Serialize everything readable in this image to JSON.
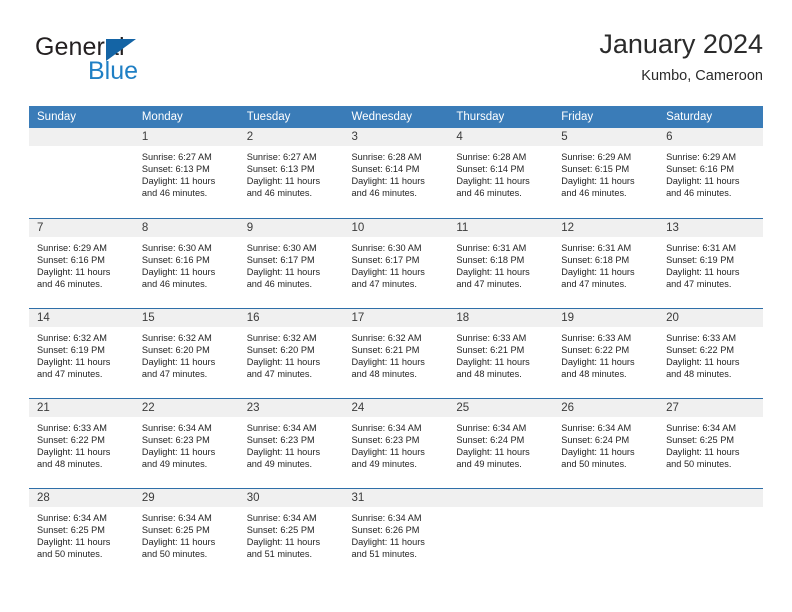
{
  "brand": {
    "name_top": "General",
    "name_bottom": "Blue",
    "flag_color": "#1464a5",
    "blue_color": "#1f7fc4"
  },
  "header": {
    "title": "January 2024",
    "subtitle": "Kumbo, Cameroon"
  },
  "theme": {
    "header_row_bg": "#3a7cb8",
    "daynum_bg": "#f0f0f0",
    "week_divider": "#2f6fa8"
  },
  "weekday_headers": [
    "Sunday",
    "Monday",
    "Tuesday",
    "Wednesday",
    "Thursday",
    "Friday",
    "Saturday"
  ],
  "weeks": [
    [
      {
        "day": "",
        "lines": []
      },
      {
        "day": "1",
        "lines": [
          "Sunrise: 6:27 AM",
          "Sunset: 6:13 PM",
          "Daylight: 11 hours",
          "and 46 minutes."
        ]
      },
      {
        "day": "2",
        "lines": [
          "Sunrise: 6:27 AM",
          "Sunset: 6:13 PM",
          "Daylight: 11 hours",
          "and 46 minutes."
        ]
      },
      {
        "day": "3",
        "lines": [
          "Sunrise: 6:28 AM",
          "Sunset: 6:14 PM",
          "Daylight: 11 hours",
          "and 46 minutes."
        ]
      },
      {
        "day": "4",
        "lines": [
          "Sunrise: 6:28 AM",
          "Sunset: 6:14 PM",
          "Daylight: 11 hours",
          "and 46 minutes."
        ]
      },
      {
        "day": "5",
        "lines": [
          "Sunrise: 6:29 AM",
          "Sunset: 6:15 PM",
          "Daylight: 11 hours",
          "and 46 minutes."
        ]
      },
      {
        "day": "6",
        "lines": [
          "Sunrise: 6:29 AM",
          "Sunset: 6:16 PM",
          "Daylight: 11 hours",
          "and 46 minutes."
        ]
      }
    ],
    [
      {
        "day": "7",
        "lines": [
          "Sunrise: 6:29 AM",
          "Sunset: 6:16 PM",
          "Daylight: 11 hours",
          "and 46 minutes."
        ]
      },
      {
        "day": "8",
        "lines": [
          "Sunrise: 6:30 AM",
          "Sunset: 6:16 PM",
          "Daylight: 11 hours",
          "and 46 minutes."
        ]
      },
      {
        "day": "9",
        "lines": [
          "Sunrise: 6:30 AM",
          "Sunset: 6:17 PM",
          "Daylight: 11 hours",
          "and 46 minutes."
        ]
      },
      {
        "day": "10",
        "lines": [
          "Sunrise: 6:30 AM",
          "Sunset: 6:17 PM",
          "Daylight: 11 hours",
          "and 47 minutes."
        ]
      },
      {
        "day": "11",
        "lines": [
          "Sunrise: 6:31 AM",
          "Sunset: 6:18 PM",
          "Daylight: 11 hours",
          "and 47 minutes."
        ]
      },
      {
        "day": "12",
        "lines": [
          "Sunrise: 6:31 AM",
          "Sunset: 6:18 PM",
          "Daylight: 11 hours",
          "and 47 minutes."
        ]
      },
      {
        "day": "13",
        "lines": [
          "Sunrise: 6:31 AM",
          "Sunset: 6:19 PM",
          "Daylight: 11 hours",
          "and 47 minutes."
        ]
      }
    ],
    [
      {
        "day": "14",
        "lines": [
          "Sunrise: 6:32 AM",
          "Sunset: 6:19 PM",
          "Daylight: 11 hours",
          "and 47 minutes."
        ]
      },
      {
        "day": "15",
        "lines": [
          "Sunrise: 6:32 AM",
          "Sunset: 6:20 PM",
          "Daylight: 11 hours",
          "and 47 minutes."
        ]
      },
      {
        "day": "16",
        "lines": [
          "Sunrise: 6:32 AM",
          "Sunset: 6:20 PM",
          "Daylight: 11 hours",
          "and 47 minutes."
        ]
      },
      {
        "day": "17",
        "lines": [
          "Sunrise: 6:32 AM",
          "Sunset: 6:21 PM",
          "Daylight: 11 hours",
          "and 48 minutes."
        ]
      },
      {
        "day": "18",
        "lines": [
          "Sunrise: 6:33 AM",
          "Sunset: 6:21 PM",
          "Daylight: 11 hours",
          "and 48 minutes."
        ]
      },
      {
        "day": "19",
        "lines": [
          "Sunrise: 6:33 AM",
          "Sunset: 6:22 PM",
          "Daylight: 11 hours",
          "and 48 minutes."
        ]
      },
      {
        "day": "20",
        "lines": [
          "Sunrise: 6:33 AM",
          "Sunset: 6:22 PM",
          "Daylight: 11 hours",
          "and 48 minutes."
        ]
      }
    ],
    [
      {
        "day": "21",
        "lines": [
          "Sunrise: 6:33 AM",
          "Sunset: 6:22 PM",
          "Daylight: 11 hours",
          "and 48 minutes."
        ]
      },
      {
        "day": "22",
        "lines": [
          "Sunrise: 6:34 AM",
          "Sunset: 6:23 PM",
          "Daylight: 11 hours",
          "and 49 minutes."
        ]
      },
      {
        "day": "23",
        "lines": [
          "Sunrise: 6:34 AM",
          "Sunset: 6:23 PM",
          "Daylight: 11 hours",
          "and 49 minutes."
        ]
      },
      {
        "day": "24",
        "lines": [
          "Sunrise: 6:34 AM",
          "Sunset: 6:23 PM",
          "Daylight: 11 hours",
          "and 49 minutes."
        ]
      },
      {
        "day": "25",
        "lines": [
          "Sunrise: 6:34 AM",
          "Sunset: 6:24 PM",
          "Daylight: 11 hours",
          "and 49 minutes."
        ]
      },
      {
        "day": "26",
        "lines": [
          "Sunrise: 6:34 AM",
          "Sunset: 6:24 PM",
          "Daylight: 11 hours",
          "and 50 minutes."
        ]
      },
      {
        "day": "27",
        "lines": [
          "Sunrise: 6:34 AM",
          "Sunset: 6:25 PM",
          "Daylight: 11 hours",
          "and 50 minutes."
        ]
      }
    ],
    [
      {
        "day": "28",
        "lines": [
          "Sunrise: 6:34 AM",
          "Sunset: 6:25 PM",
          "Daylight: 11 hours",
          "and 50 minutes."
        ]
      },
      {
        "day": "29",
        "lines": [
          "Sunrise: 6:34 AM",
          "Sunset: 6:25 PM",
          "Daylight: 11 hours",
          "and 50 minutes."
        ]
      },
      {
        "day": "30",
        "lines": [
          "Sunrise: 6:34 AM",
          "Sunset: 6:25 PM",
          "Daylight: 11 hours",
          "and 51 minutes."
        ]
      },
      {
        "day": "31",
        "lines": [
          "Sunrise: 6:34 AM",
          "Sunset: 6:26 PM",
          "Daylight: 11 hours",
          "and 51 minutes."
        ]
      },
      {
        "day": "",
        "lines": []
      },
      {
        "day": "",
        "lines": []
      },
      {
        "day": "",
        "lines": []
      }
    ]
  ]
}
